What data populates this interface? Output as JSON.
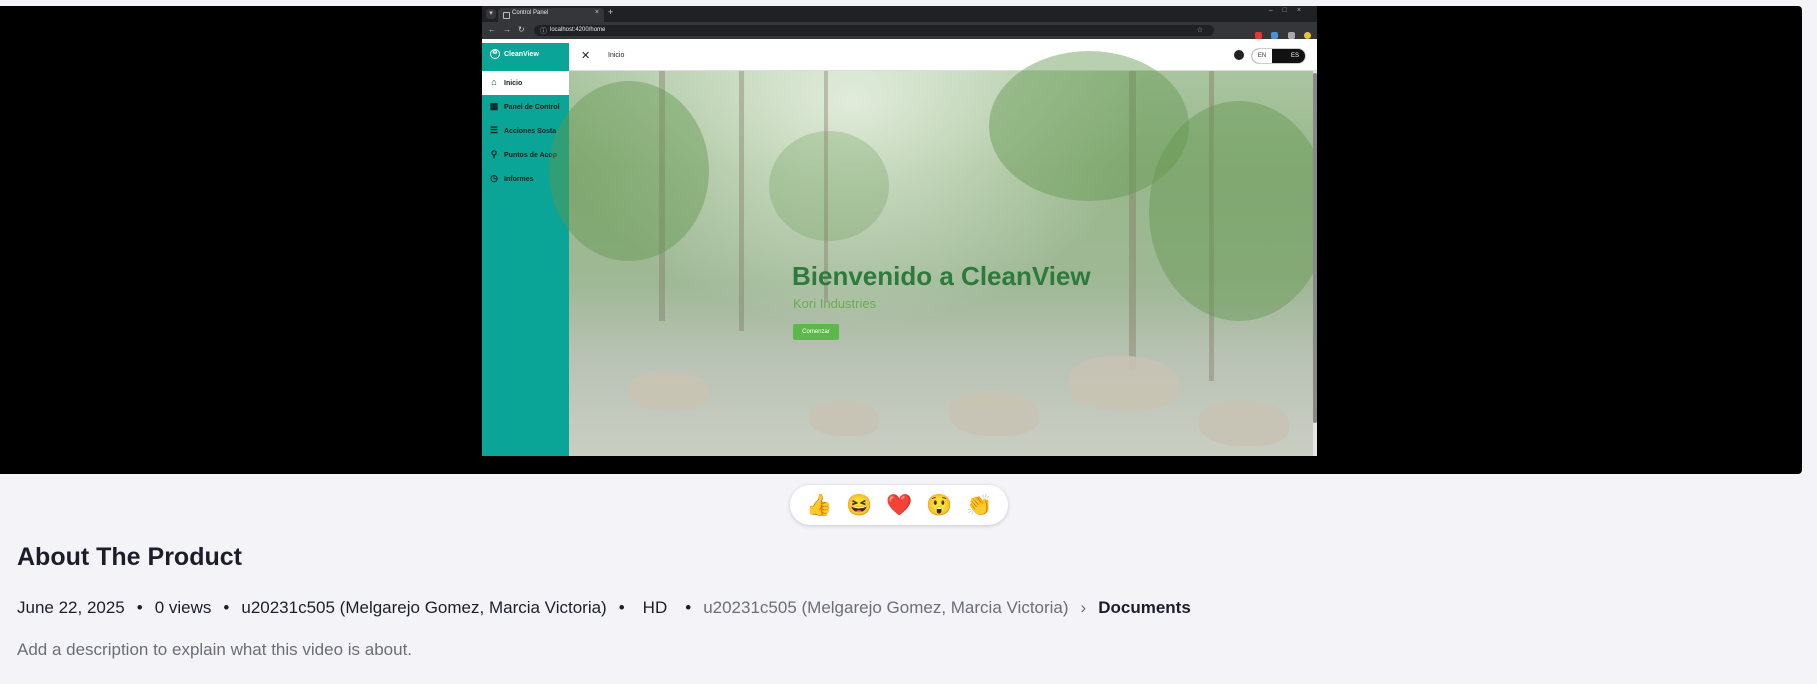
{
  "browser": {
    "tab_title": "Control Panel",
    "url": "localhost:4200/home"
  },
  "app": {
    "brand": "CleanView",
    "breadcrumb": "Inicio",
    "sidebar": [
      {
        "label": "Inicio",
        "icon": "home-icon"
      },
      {
        "label": "Panel de Control",
        "icon": "dashboard-icon"
      },
      {
        "label": "Acciones Sosta",
        "icon": "actions-icon"
      },
      {
        "label": "Puntos de Acop",
        "icon": "collection-point-icon"
      },
      {
        "label": "Informes",
        "icon": "clock-icon"
      }
    ],
    "lang": {
      "en": "EN",
      "es": "ES",
      "selected": "ES"
    },
    "hero": {
      "title": "Bienvenido a CleanView",
      "subtitle": "Kori Industries",
      "button": "Comenzar"
    }
  },
  "reactions": [
    "👍",
    "😆",
    "❤️",
    "😲",
    "👏"
  ],
  "about": {
    "heading": "About The Product",
    "date": "June 22, 2025",
    "views": "0 views",
    "author": "u20231c505 (Melgarejo Gomez, Marcia Victoria)",
    "quality": "HD",
    "folder_owner": "u20231c505 (Melgarejo Gomez, Marcia Victoria)",
    "folder": "Documents",
    "description": "Add a description to explain what this video is about."
  },
  "colors": {
    "sidebar": "#0aa596",
    "hero_title": "#2e7a3c",
    "button": "#5cb84a"
  }
}
